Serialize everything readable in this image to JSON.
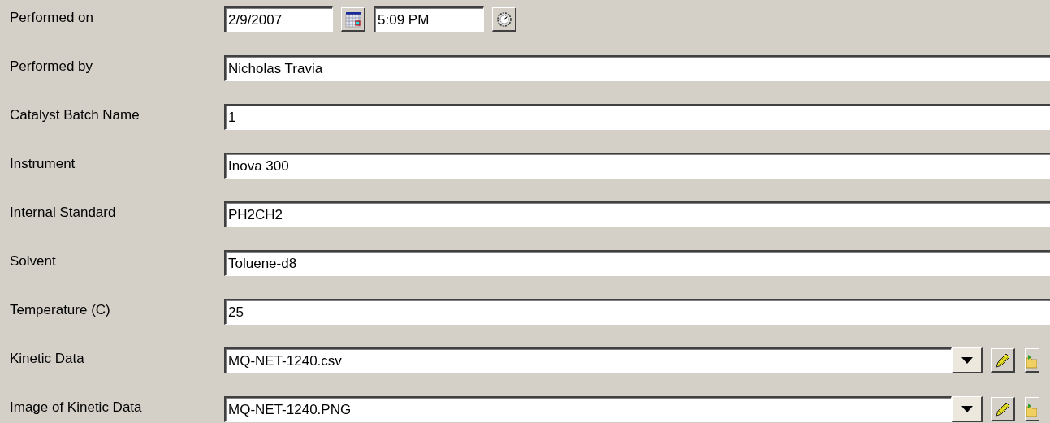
{
  "rows": [
    {
      "kind": "datetime",
      "label": "Performed on",
      "date": "2/9/2007",
      "time": "5:09 PM"
    },
    {
      "kind": "text",
      "label": "Performed by",
      "value": "Nicholas Travia"
    },
    {
      "kind": "text",
      "label": "Catalyst Batch Name",
      "value": "1"
    },
    {
      "kind": "text",
      "label": "Instrument",
      "value": "Inova 300"
    },
    {
      "kind": "text",
      "label": "Internal Standard",
      "value": "PH2CH2"
    },
    {
      "kind": "text",
      "label": "Solvent",
      "value": "Toluene-d8"
    },
    {
      "kind": "text",
      "label": "Temperature (C)",
      "value": "25"
    },
    {
      "kind": "file",
      "label": "Kinetic Data",
      "value": "MQ-NET-1240.csv"
    },
    {
      "kind": "file",
      "label": "Image of Kinetic Data",
      "value": "MQ-NET-1240.PNG"
    }
  ]
}
